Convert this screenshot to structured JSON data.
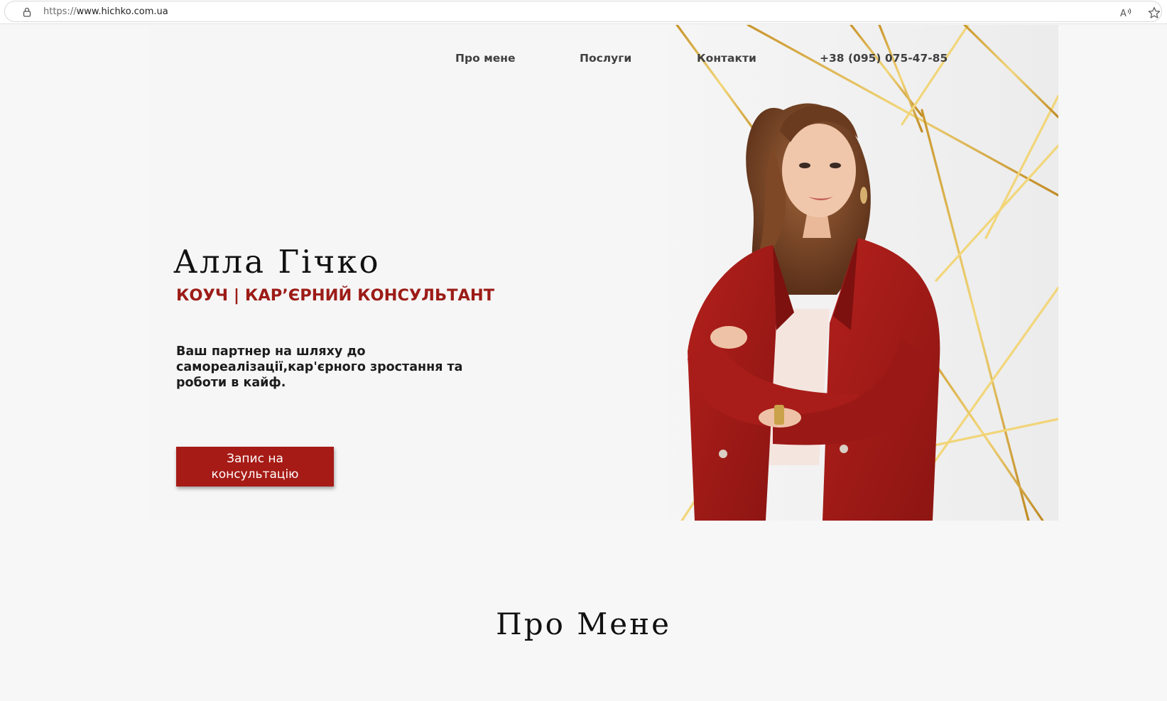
{
  "browser": {
    "url_scheme": "https://",
    "url_host": "www.hichko.com.ua",
    "icons": [
      "lock-icon",
      "read-aloud-icon",
      "favorite-star-icon"
    ]
  },
  "nav": {
    "items": [
      {
        "label": "Про мене"
      },
      {
        "label": "Послуги"
      },
      {
        "label": "Контакти"
      },
      {
        "label": "+38 (095) 075-47-85"
      }
    ]
  },
  "hero": {
    "name": "Алла Гічко",
    "role": "КОУЧ | КАР’ЄРНИЙ КОНСУЛЬТАНТ",
    "tagline": "Ваш партнер на шляху до самореалізації,кар'єрного зростання та роботи в кайф.",
    "cta_label": "Запис на консультацію",
    "accent_color": "#a61b16",
    "gold_color": "#d4a93a"
  },
  "about": {
    "title": "Про Мене"
  }
}
